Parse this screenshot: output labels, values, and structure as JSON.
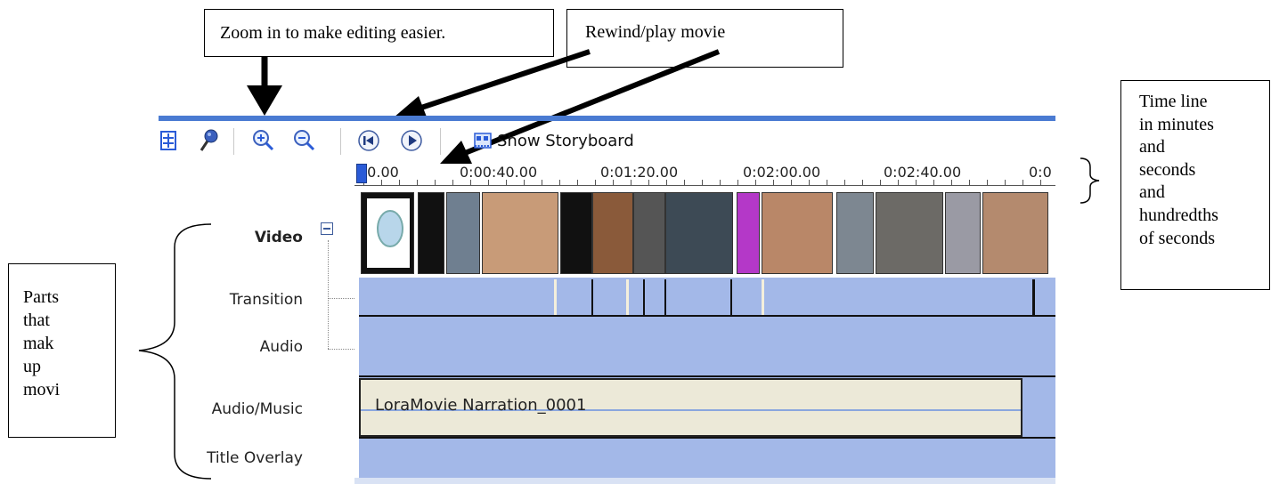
{
  "callouts": {
    "zoom": "Zoom in to make editing easier.",
    "rewind": "Rewind/play movie",
    "timeline": [
      "Time line",
      "in minutes",
      "and",
      "seconds",
      "and",
      "hundredths",
      "of seconds"
    ],
    "parts": [
      "Parts",
      "that",
      "mak",
      "up",
      "movi"
    ]
  },
  "toolbar": {
    "icons": [
      "timeline-settings-icon",
      "narrate-microphone-icon",
      "zoom-in-icon",
      "zoom-out-icon",
      "rewind-icon",
      "play-icon",
      "storyboard-icon"
    ],
    "show_storyboard_label": "Show Storyboard"
  },
  "ruler": {
    "ticks": [
      "00.00",
      "0:00:40.00",
      "0:01:20.00",
      "0:02:00.00",
      "0:02:40.00",
      "0:0"
    ]
  },
  "tracks": {
    "video": "Video",
    "transition": "Transition",
    "audio": "Audio",
    "audio_music": "Audio/Music",
    "title_overlay": "Title Overlay"
  },
  "audio_clip": {
    "name": "LoraMovie Narration_0001"
  },
  "colors": {
    "accent": "#4a7bd2",
    "lane": "#a3b8e8",
    "audio_clip_bg": "#ece9d8"
  }
}
